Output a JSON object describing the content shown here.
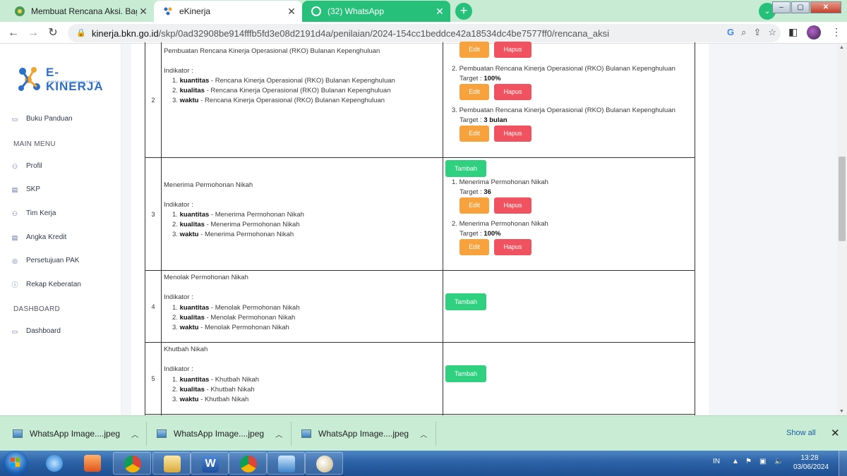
{
  "browser": {
    "tabs": [
      {
        "title": "Membuat Rencana Aksi. Bagian I"
      },
      {
        "title": "eKinerja"
      },
      {
        "title": "(32) WhatsApp"
      }
    ],
    "url_host": "kinerja.bkn.go.id",
    "url_path": "/skp/0ad32908be914fffb5fd3e08d2191d4a/penilaian/2024-154cc1beddce42a18534dc4be7577ff0/rencana_aksi"
  },
  "sidebar": {
    "logo_text": "E-KINERJA",
    "logo_sub": "BADAN KEPEGAWAIAN NEGARA",
    "buku_panduan": "Buku Panduan",
    "main_menu_heading": "MAIN MENU",
    "items": [
      {
        "label": "Profil"
      },
      {
        "label": "SKP"
      },
      {
        "label": "Tim Kerja"
      },
      {
        "label": "Angka Kredit"
      },
      {
        "label": "Persetujuan PAK"
      },
      {
        "label": "Rekap Keberatan"
      }
    ],
    "dashboard_heading": "DASHBOARD",
    "dashboard_item": "Dashboard"
  },
  "labels": {
    "indikator": "Indikator :",
    "edit": "Edit",
    "hapus": "Hapus",
    "tambah": "Tambah",
    "target": "Target :",
    "kuantitas": "kuantitas",
    "kualitas": "kualitas",
    "waktu": "waktu"
  },
  "rows": [
    {
      "no": "2",
      "title": "Pembuatan Rencana Kinerja Operasional (RKO) Bulanan Kepenghuluan",
      "ind_kuantitas": " - Rencana Kinerja Operasional (RKO) Bulanan Kepenghuluan",
      "ind_kualitas": " - Rencana Kinerja Operasional (RKO) Bulanan Kepenghuluan",
      "ind_waktu": " - Rencana Kinerja Operasional (RKO) Bulanan Kepenghuluan",
      "aksi": [
        {
          "num": "2.",
          "text": "Pembuatan Rencana Kinerja Operasional (RKO) Bulanan Kepenghuluan",
          "target": "100%"
        },
        {
          "num": "3.",
          "text": "Pembuatan Rencana Kinerja Operasional (RKO) Bulanan Kepenghuluan",
          "target": "3 bulan"
        }
      ]
    },
    {
      "no": "3",
      "title": "Menerima Permohonan Nikah",
      "ind_kuantitas": " - Menerima Permohonan Nikah",
      "ind_kualitas": " - Menerima Permohonan Nikah",
      "ind_waktu": " - Menerima Permohonan Nikah",
      "aksi": [
        {
          "num": "1.",
          "text": "Menerima Permohonan Nikah",
          "target": "36"
        },
        {
          "num": "2.",
          "text": "Menerima Permohonan Nikah",
          "target": "100%"
        }
      ]
    },
    {
      "no": "4",
      "title": "Menolak Permohonan Nikah",
      "ind_kuantitas": " - Menolak Permohonan Nikah",
      "ind_kualitas": " - Menolak Permohonan Nikah",
      "ind_waktu": " - Menolak Permohonan Nikah"
    },
    {
      "no": "5",
      "title": "Khutbah Nikah",
      "ind_kuantitas": " - Khutbah Nikah",
      "ind_kualitas": " - Khutbah Nikah",
      "ind_waktu": " - Khutbah Nikah"
    }
  ],
  "downloads": [
    {
      "name": "WhatsApp Image....jpeg"
    },
    {
      "name": "WhatsApp Image....jpeg"
    },
    {
      "name": "WhatsApp Image....jpeg"
    }
  ],
  "downloads_show_all": "Show all",
  "taskbar": {
    "lang": "IN",
    "time": "13:28",
    "date": "03/06/2024"
  }
}
